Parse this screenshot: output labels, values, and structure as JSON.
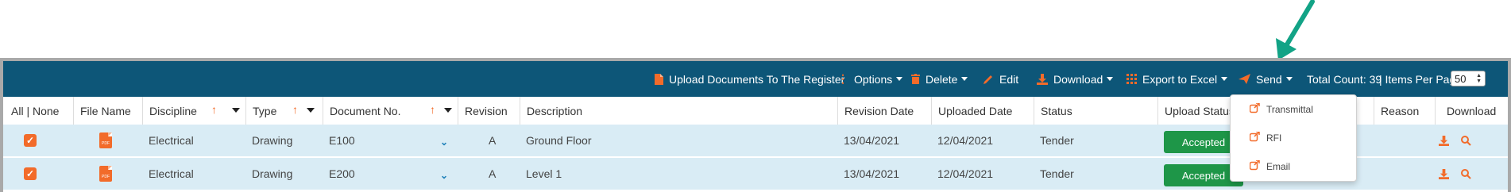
{
  "toolbar": {
    "upload_label": "Upload Documents To The Register",
    "options_label": "Options",
    "delete_label": "Delete",
    "edit_label": "Edit",
    "download_label": "Download",
    "export_label": "Export to Excel",
    "send_label": "Send",
    "total_count": "Total Count: 39",
    "items_per_page_label": "| Items Per Page",
    "items_per_page_value": "50"
  },
  "table": {
    "headers": {
      "select": "All | None",
      "file_name": "File Name",
      "discipline": "Discipline",
      "type": "Type",
      "document_no": "Document No.",
      "revision": "Revision",
      "description": "Description",
      "revision_date": "Revision Date",
      "uploaded_date": "Uploaded Date",
      "status": "Status",
      "upload_status": "Upload Status",
      "reason": "Reason",
      "download": "Download"
    },
    "rows": [
      {
        "discipline": "Electrical",
        "type": "Drawing",
        "document_no": "E100",
        "revision": "A",
        "description": "Ground Floor",
        "revision_date": "13/04/2021",
        "uploaded_date": "12/04/2021",
        "status": "Tender",
        "upload_status": "Accepted"
      },
      {
        "discipline": "Electrical",
        "type": "Drawing",
        "document_no": "E200",
        "revision": "A",
        "description": "Level 1",
        "revision_date": "13/04/2021",
        "uploaded_date": "12/04/2021",
        "status": "Tender",
        "upload_status": "Accepted"
      }
    ]
  },
  "send_menu": {
    "items": [
      "Transmittal",
      "RFI",
      "Email"
    ]
  },
  "icons": {
    "pdf_badge": "PDF"
  },
  "colors": {
    "toolbar_bg": "#0d5678",
    "accent": "#f26b2a",
    "accepted": "#1e9648",
    "row_bg": "#d9ecf5",
    "annotation_arrow": "#12a386"
  }
}
